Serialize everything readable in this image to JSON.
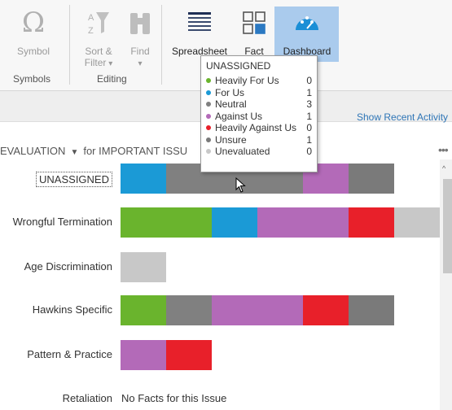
{
  "ribbon": {
    "symbol_label": "Symbol",
    "sort_filter_label": "Sort &",
    "sort_filter_label2": "Filter",
    "find_label": "Find",
    "spreadsheet_label": "Spreadsheet",
    "fact_label": "Fact",
    "dashboard_label": "Dashboard",
    "group_symbols": "Symbols",
    "group_editing": "Editing"
  },
  "recent_activity": "Show Recent Activity",
  "evaluation": {
    "header": "EVALUATION",
    "scope": "for IMPORTANT ISSU"
  },
  "colors": {
    "heavily_for": "#6ab42d",
    "for": "#1b9ad6",
    "neutral": "#808080",
    "against": "#b36ab8",
    "heavily_against": "#e8202a",
    "unsure": "#7a7a7a",
    "unevaluated": "#c8c8c8"
  },
  "rows": [
    {
      "label": "UNASSIGNED",
      "selected": true,
      "segments": [
        {
          "key": "for",
          "count": 1
        },
        {
          "key": "neutral",
          "count": 3
        },
        {
          "key": "against",
          "count": 1
        },
        {
          "key": "unsure",
          "count": 1
        }
      ]
    },
    {
      "label": "Wrongful Termination",
      "segments": [
        {
          "key": "heavily_for",
          "count": 2
        },
        {
          "key": "for",
          "count": 1
        },
        {
          "key": "against",
          "count": 2
        },
        {
          "key": "heavily_against",
          "count": 1
        },
        {
          "key": "unevaluated",
          "count": 1
        }
      ]
    },
    {
      "label": "Age Discrimination",
      "segments": [
        {
          "key": "unevaluated",
          "count": 1
        }
      ]
    },
    {
      "label": "Hawkins Specific",
      "segments": [
        {
          "key": "heavily_for",
          "count": 1
        },
        {
          "key": "neutral",
          "count": 1
        },
        {
          "key": "against",
          "count": 2
        },
        {
          "key": "heavily_against",
          "count": 1
        },
        {
          "key": "unsure",
          "count": 1
        }
      ]
    },
    {
      "label": "Pattern & Practice",
      "segments": [
        {
          "key": "against",
          "count": 1
        },
        {
          "key": "heavily_against",
          "count": 1
        }
      ]
    },
    {
      "label": "Retaliation",
      "segments": [],
      "empty_text": "No Facts for this Issue"
    }
  ],
  "popup": {
    "title": "UNASSIGNED",
    "items": [
      {
        "label": "Heavily For Us",
        "count": "0",
        "key": "heavily_for"
      },
      {
        "label": "For Us",
        "count": "1",
        "key": "for"
      },
      {
        "label": "Neutral",
        "count": "3",
        "key": "neutral"
      },
      {
        "label": "Against Us",
        "count": "1",
        "key": "against"
      },
      {
        "label": "Heavily Against Us",
        "count": "0",
        "key": "heavily_against"
      },
      {
        "label": "Unsure",
        "count": "1",
        "key": "unsure"
      },
      {
        "label": "Unevaluated",
        "count": "0",
        "key": "unevaluated"
      }
    ]
  }
}
